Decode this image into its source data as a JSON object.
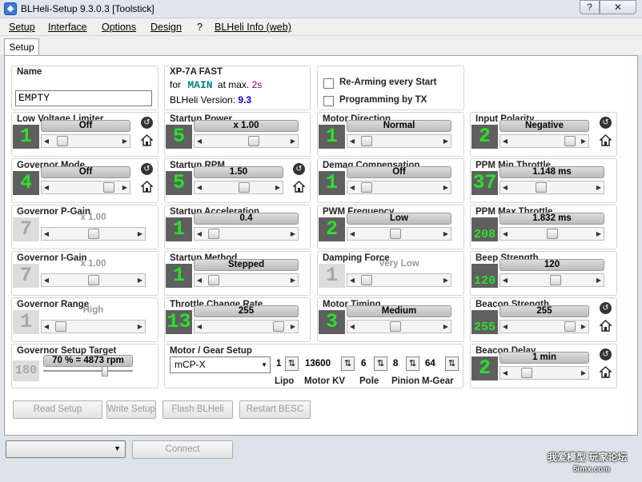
{
  "window": {
    "title": "BLHeli-Setup 9.3.0.3 [Toolstick]",
    "help_label": "?",
    "close_label": "✕"
  },
  "menu": [
    "Setup",
    "Interface",
    "Options",
    "Design",
    "?",
    "BLHeli Info (web)"
  ],
  "tab": {
    "label": "Setup"
  },
  "name_box": {
    "label": "Name",
    "value": "EMPTY"
  },
  "esc_info": {
    "model": "XP-7A FAST",
    "for_label": "for",
    "main": "MAIN",
    "at_max": "at max.",
    "time": "2s",
    "version_label": "BLHeli Version:",
    "version": "9.3"
  },
  "options": {
    "rearm_label": "Re-Arming every Start",
    "programming_label": "Programming by TX"
  },
  "params": [
    {
      "label": "Low Voltage Limiter",
      "value": "Off",
      "num": "1",
      "pos": 0.1,
      "enabled": true,
      "icons": true
    },
    {
      "label": "Startup Power",
      "value": "x 1.00",
      "num": "5",
      "pos": 0.6,
      "enabled": true,
      "icons": false
    },
    {
      "label": "Motor Direction",
      "value": "Normal",
      "num": "1",
      "pos": 0.05,
      "enabled": true,
      "icons": false
    },
    {
      "label": "Input Polarity",
      "value": "Negative",
      "num": "2",
      "pos": 0.95,
      "enabled": true,
      "icons": true
    },
    {
      "label": "Governor Mode",
      "value": "Off",
      "num": "4",
      "pos": 0.9,
      "enabled": true,
      "icons": true
    },
    {
      "label": "Startup RPM",
      "value": "1.50",
      "num": "5",
      "pos": 0.6,
      "enabled": true,
      "icons": true
    },
    {
      "label": "Demag Compensation",
      "value": "Off",
      "num": "1",
      "pos": 0.05,
      "enabled": true,
      "icons": false
    },
    {
      "label": "PPM Min Throttle",
      "value": "1.148 ms",
      "num": "37",
      "pos": 0.35,
      "enabled": true,
      "icons": false
    },
    {
      "label": "Governor P-Gain",
      "value": "x 1.00",
      "num": "7",
      "pos": 0.5,
      "enabled": false,
      "icons": false
    },
    {
      "label": "Startup Acceleration",
      "value": "0.4",
      "num": "1",
      "pos": 0.05,
      "enabled": true,
      "icons": false
    },
    {
      "label": "PWM Frequency",
      "value": "Low",
      "num": "2",
      "pos": 0.45,
      "enabled": true,
      "icons": false
    },
    {
      "label": "PPM Max Throttle",
      "value": "1.832 ms",
      "num": "208",
      "pos": 0.5,
      "enabled": true,
      "icons": false
    },
    {
      "label": "Governor I-Gain",
      "value": "x 1.00",
      "num": "7",
      "pos": 0.5,
      "enabled": false,
      "icons": false
    },
    {
      "label": "Startup Method",
      "value": "Stepped",
      "num": "1",
      "pos": 0.05,
      "enabled": true,
      "icons": false
    },
    {
      "label": "Damping Force",
      "value": "Very Low",
      "num": "1",
      "pos": 0.05,
      "enabled": false,
      "icons": false
    },
    {
      "label": "Beep Strength",
      "value": "120",
      "num": "120",
      "pos": 0.55,
      "enabled": true,
      "icons": false
    },
    {
      "label": "Governor Range",
      "value": "High",
      "num": "1",
      "pos": 0.05,
      "enabled": false,
      "icons": false
    },
    {
      "label": "Throttle Change  Rate",
      "value": "255",
      "num": "13",
      "pos": 0.95,
      "enabled": true,
      "icons": false
    },
    {
      "label": "Motor Timing",
      "value": "Medium",
      "num": "3",
      "pos": 0.45,
      "enabled": true,
      "icons": false
    },
    {
      "label": "Beacon Strength",
      "value": "255",
      "num": "255",
      "pos": 0.95,
      "enabled": true,
      "icons": true
    },
    {
      "label": "Beacon Delay",
      "value": "1 min",
      "num": "2",
      "pos": 0.2,
      "enabled": true,
      "icons": true
    }
  ],
  "gov_target": {
    "label": "Governor Setup Target",
    "value": "70 % = 4873 rpm",
    "num": "180",
    "pos": 0.7
  },
  "motor_gear": {
    "label": "Motor / Gear Setup",
    "select": "mCP-X",
    "values": [
      "1",
      "13600",
      "6",
      "8",
      "64"
    ],
    "labels": [
      "Lipo",
      "Motor KV",
      "Pole",
      "Pinion",
      "M-Gear"
    ]
  },
  "buttons": {
    "read": "Read Setup",
    "write": "Write Setup",
    "flash": "Flash BLHeli",
    "restart": "Restart BESC",
    "connect": "Connect"
  },
  "watermark": {
    "line1": "我爱模型 玩家论坛",
    "line2": "5imx.com"
  }
}
